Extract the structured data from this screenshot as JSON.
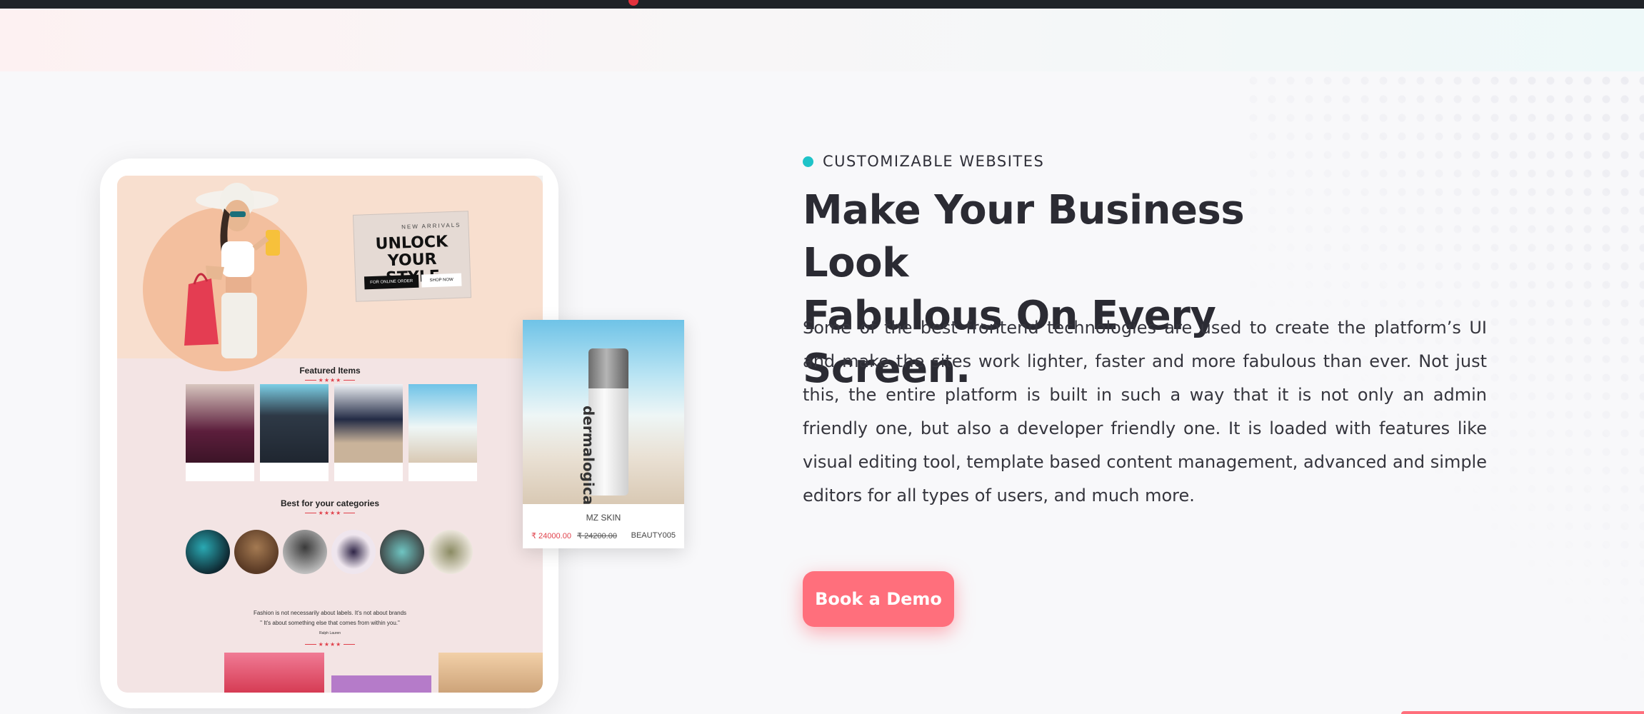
{
  "colors": {
    "accent": "#ff6f7c",
    "teal": "#1fc3c8",
    "heading": "#2b2b33",
    "price_red": "#e0414b"
  },
  "section": {
    "eyebrow": "CUSTOMIZABLE WEBSITES",
    "heading_line1": "Make Your Business Look",
    "heading_line2": "Fabulous On Every Screen.",
    "description": "Some of the best frontend technologies are used to create the platform’s UI and make the sites work lighter, faster and more fabulous than ever. Not just this, the entire platform is built in such a way that it is not only an admin friendly one, but also a developer friendly one. It is loaded with features like visual editing tool, template based content management, advanced and simple editors for all types of users, and much more.",
    "cta_label": "Book a Demo"
  },
  "mockup": {
    "promo_small": "NEW ARRIVALS",
    "promo_big": "UNLOCK YOUR STYLE",
    "promo_btn1": "FOR ONLINE ORDER",
    "promo_btn2": "SHOP NOW",
    "featured_title": "Featured Items",
    "category_title": "Best for your categories",
    "quote_line1": "Fashion is not necessarily about labels. It's not about brands",
    "quote_line2": "\" It's about something else that comes from within you.\"",
    "quote_author": "Ralph Lauren",
    "stars": "★★★★",
    "card": {
      "name": "MZ SKIN",
      "price": "₹ 24000.00",
      "old_price": "₹ 24200.00",
      "code": "BEAUTY005",
      "brand": "dermalogica"
    }
  }
}
